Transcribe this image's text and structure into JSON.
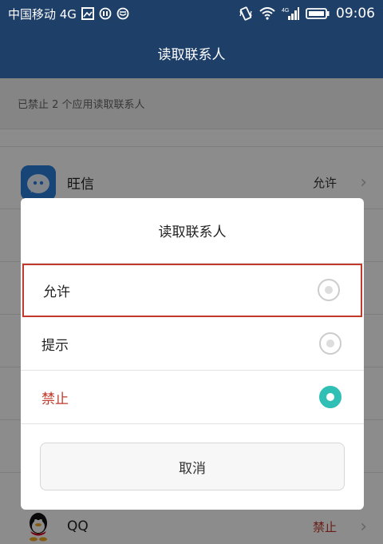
{
  "status_bar": {
    "carrier": "中国移动 4G",
    "time": "09:06",
    "icons": [
      "image-icon",
      "settings-icon",
      "emoji-icon",
      "vibrate-icon",
      "wifi-icon",
      "signal-4g-icon",
      "battery-icon"
    ]
  },
  "header": {
    "title": "读取联系人"
  },
  "summary": {
    "text": "已禁止 2 个应用读取联系人"
  },
  "apps": [
    {
      "name": "旺信",
      "status": "允许",
      "icon": "wangxin-app-icon"
    },
    {
      "name": "QQ",
      "status": "禁止",
      "icon": "qq-app-icon"
    }
  ],
  "dialog": {
    "title": "读取联系人",
    "options": [
      {
        "label": "允许",
        "selected": false
      },
      {
        "label": "提示",
        "selected": false
      },
      {
        "label": "禁止",
        "selected": true
      }
    ],
    "cancel_label": "取消"
  },
  "colors": {
    "header_bg": "#1e3f68",
    "accent": "#2fbfb5",
    "deny_red": "#c0392b",
    "highlight_box": "#c0392b"
  }
}
